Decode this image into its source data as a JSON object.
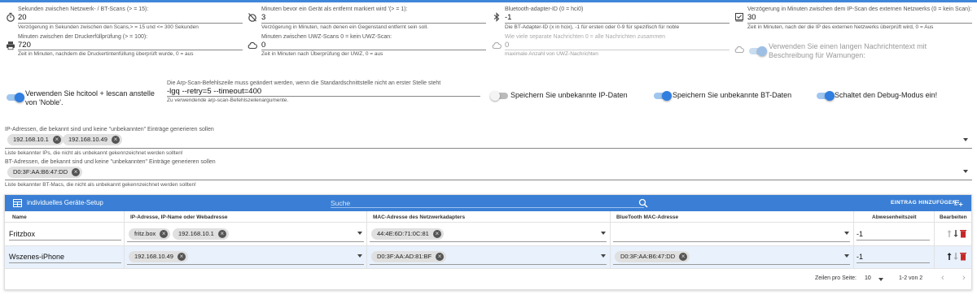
{
  "settings": {
    "scan_interval": {
      "label": "Sekunden zwischen Netzwerk- / BT-Scans (> = 15):",
      "value": "20",
      "help": "Verzögerung in Sekunden zwischen den Scans,> = 15 und <= 300 Sekunden"
    },
    "absent_minutes": {
      "label": "Minuten bevor ein Gerät als entfernt markiert wird '(> = 1):",
      "value": "3",
      "help": "Verzögerung in Minuten, nach denen ein Gegenstand entfernt sein soll."
    },
    "bt_adapter": {
      "label": "Bluetooth-adapter-ID (0 = hci0)",
      "value": "-1",
      "help": "Die BT-Adapter-ID (x in hcix), -1 für ersten oder 0-9 für spezifisch für noble"
    },
    "ext_ip_delay": {
      "label": "Verzögerung in Minuten zwischen dem IP-Scan des externen Netzwerks (0 = kein Scan):",
      "value": "30",
      "help": "Zeit in Minuten, nach der die IP des externen Netzwerks überprüft wird, 0 = Aus"
    },
    "printer_minutes": {
      "label": "Minuten zwischen der Druckerfüllprüfung (> = 100):",
      "value": "720",
      "help": "Zeit in Minuten, nachdem die Druckertintenfüllung überprüft wurde, 0 = aus"
    },
    "uwz_minutes": {
      "label": "Minuten zwischen UWZ-Scans 0 = kein UWZ-Scan:",
      "value": "0",
      "help": "Zeit in Minuten nach Überprüfung der UWZ, 0 = aus"
    },
    "uwz_messages": {
      "label": "Wie viele separate Nachrichten 0 = alle Nachrichten zusammen",
      "value": "0",
      "help": "maximale Anzahl von UWZ-Nachrichten"
    },
    "long_messages": {
      "label": "Verwenden Sie einen langen Nachrichtentext mit Beschreibung für Wamungen:",
      "on": true,
      "disabled": true
    },
    "hcitool": {
      "label": "Verwenden Sie hcitool + lescan anstelle von 'Noble'.",
      "on": true
    },
    "arp_scan": {
      "label": "Die Arp-Scan-Befehlszeile muss geändert werden, wenn die Standardschnittstelle nicht an erster Stelle steht",
      "value": "-lgq --retry=5 --timeout=400",
      "help": "Zu verwendende arp-scan-Befehlszeilenargumente."
    },
    "save_unknown_ip": {
      "label": "Speichern Sie unbekannte IP-Daten",
      "on": false
    },
    "save_unknown_bt": {
      "label": "Speichern Sie unbekannte BT-Daten",
      "on": true
    },
    "debug": {
      "label": "Schaltet den Debug-Modus ein!",
      "on": true
    }
  },
  "known_ips": {
    "label": "IP-Adressen, die bekannt sind und keine \"unbekannten\" Einträge generieren sollen",
    "chips": [
      "192.168.10.1",
      "192.168.10.49"
    ],
    "help": "Liste bekannter IPs, die nicht als unbekannt gekennzeichnet werden sollten!"
  },
  "known_bt": {
    "label": "BT-Adressen, die bekannt sind und keine \"unbekannten\" Einträge generieren sollen",
    "chips": [
      "D0:3F:AA:B6:47:DD"
    ],
    "help": "Liste bekannter BT-Macs, die nicht als unbekannt gekennzeichnet werden sollten!"
  },
  "table": {
    "title": "individuelles Geräte-Setup",
    "search_placeholder": "Suche",
    "add_label": "EINTRAG HINZUFÜGEN",
    "headers": [
      "Name",
      "IP-Adresse, IP-Name oder Webadresse",
      "MAC-Adresse des Netzwerkadapters",
      "BlueTooth MAC-Adresse",
      "Abwesenheitszeit",
      "Bearbeiten"
    ],
    "rows": [
      {
        "name": "Fritzbox",
        "ips": [
          "fritz.box",
          "192.168.10.1"
        ],
        "macs": [
          "44:4E:6D:71:0C:81"
        ],
        "bt": [],
        "absence": "-1"
      },
      {
        "name": "Wszenes-iPhone",
        "ips": [
          "192.168.10.49"
        ],
        "macs": [
          "D0:3F:AA:AD:81:BF"
        ],
        "bt": [
          "D0:3F:AA:B6:47:DD"
        ],
        "absence": "-1"
      }
    ],
    "footer": {
      "rows_per_page_label": "Zeilen pro Seite:",
      "rows_per_page": "10",
      "range": "1-2 von 2"
    }
  },
  "colors": {
    "accent": "#3a7fd5",
    "selected_row": "#e8f1fc"
  }
}
